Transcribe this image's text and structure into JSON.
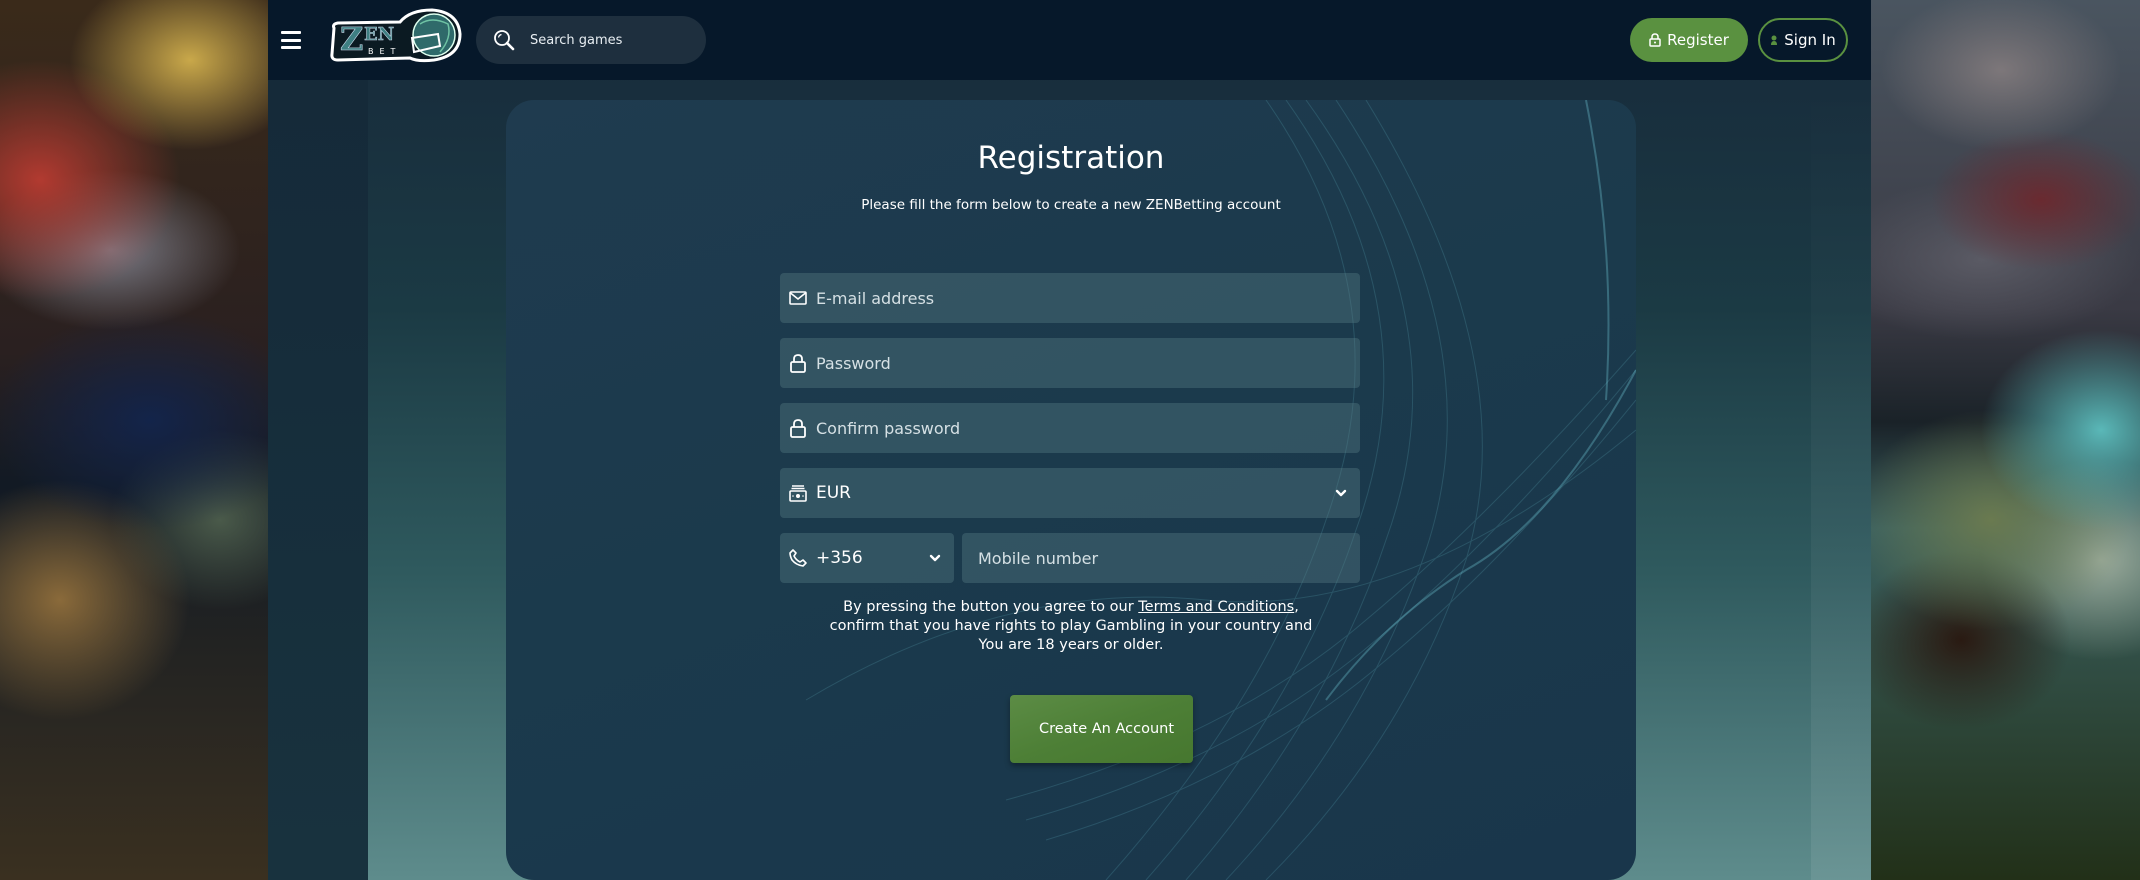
{
  "header": {
    "menu_icon": "hamburger-icon",
    "logo": {
      "text_top": "ZEN",
      "text_bottom": "BET",
      "icon": "football-helmet-icon"
    },
    "search": {
      "placeholder": "Search games",
      "value": "",
      "icon": "search-icon"
    },
    "register_button": {
      "label": "Register",
      "icon": "lock-icon"
    },
    "signin_button": {
      "label": "Sign In",
      "icon": "user-icon"
    }
  },
  "registration": {
    "title": "Registration",
    "subtitle": "Please fill the form below to create a new ZENBetting account",
    "fields": {
      "email": {
        "placeholder": "E-mail address",
        "value": "",
        "icon": "envelope-icon"
      },
      "password": {
        "placeholder": "Password",
        "value": "",
        "icon": "lock-icon"
      },
      "confirm_password": {
        "placeholder": "Confirm password",
        "value": "",
        "icon": "lock-icon"
      },
      "currency": {
        "selected": "EUR",
        "icon": "money-icon"
      },
      "phone_code": {
        "selected": "+356",
        "icon": "phone-icon"
      },
      "mobile": {
        "placeholder": "Mobile number",
        "value": ""
      }
    },
    "terms": {
      "before": "By pressing the button you agree to our ",
      "link": "Terms and Conditions",
      "after": ", confirm that you have rights to play Gambling in your country and You are 18 years or older."
    },
    "submit_label": "Create An Account"
  },
  "colors": {
    "accent_green": "#5a9140",
    "header_bg": "#06182a",
    "card_bg": "#1d3a4d"
  }
}
